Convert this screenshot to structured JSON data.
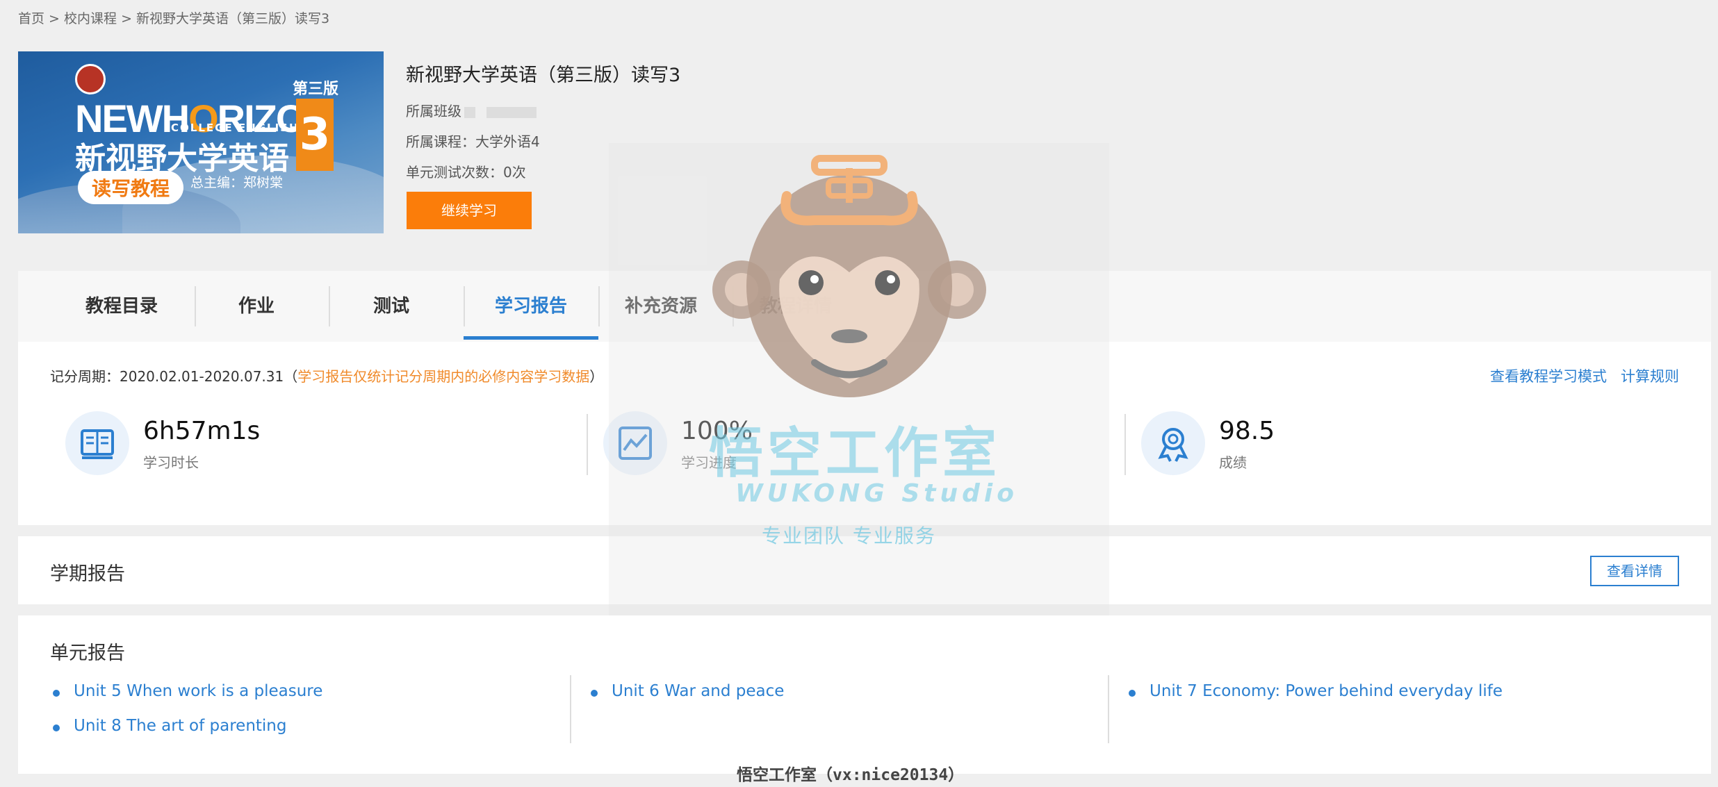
{
  "breadcrumb": [
    "首页",
    "校内课程",
    "新视野大学英语（第三版）读写3"
  ],
  "breadcrumb_sep": " > ",
  "cover": {
    "edition": "第三版",
    "brand_new": "NEW",
    "brand_h": "H",
    "brand_o": "O",
    "brand_rizon": "RIZON",
    "brand_sub": "COLLEGE ENGLISH",
    "cn_title": "新视野大学英语",
    "number": "3",
    "pill": "读写教程",
    "editor": "总主编：郑树棠"
  },
  "course": {
    "title": "新视野大学英语（第三版）读写3",
    "class_label": "所属班级",
    "course_label": "所属课程：大学外语4",
    "tests_label": "单元测试次数：0次",
    "continue_label": "继续学习"
  },
  "tabs": [
    {
      "label": "教程目录",
      "active": false
    },
    {
      "label": "作业",
      "active": false
    },
    {
      "label": "测试",
      "active": false
    },
    {
      "label": "学习报告",
      "active": true
    },
    {
      "label": "补充资源",
      "active": false
    },
    {
      "label": "教程详情",
      "active": false
    }
  ],
  "stats": {
    "period_prefix": "记分周期：2020.02.01-2020.07.31（",
    "period_note": "学习报告仅统计记分周期内的必修内容学习数据",
    "period_suffix": "）",
    "link_mode": "查看教程学习模式",
    "link_rules": "计算规则",
    "items": [
      {
        "value": "6h57m1s",
        "label": "学习时长",
        "icon": "book-icon"
      },
      {
        "value": "100%",
        "label": "学习进度",
        "icon": "progress-chart-icon"
      },
      {
        "value": "98.5",
        "label": "成绩",
        "icon": "award-icon"
      }
    ]
  },
  "semester": {
    "title": "学期报告",
    "detail_label": "查看详情"
  },
  "units": {
    "title": "单元报告",
    "items": [
      "Unit 5 When work is a pleasure",
      "Unit 6 War and peace",
      "Unit 7 Economy: Power behind everyday life",
      "Unit 8 The art of parenting"
    ]
  },
  "watermark": {
    "cn": "悟空工作室",
    "en": "WUKONG Studio",
    "slogan": "专业团队 专业服务",
    "footer": "悟空工作室（vx:nice20134）"
  },
  "colors": {
    "accent": "#2b7fd0",
    "orange": "#fb7d0a",
    "note": "#f08a2a"
  }
}
